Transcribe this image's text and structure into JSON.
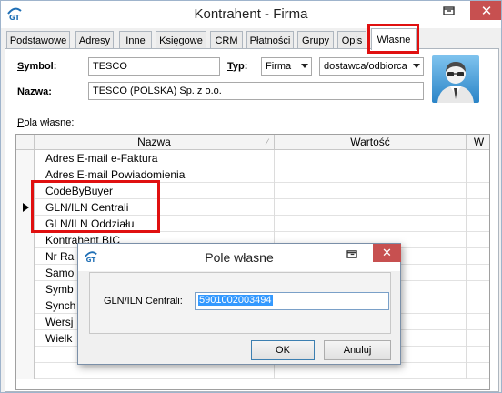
{
  "window": {
    "title": "Kontrahent - Firma",
    "close_glyph": "✕",
    "icons": [
      "app-logo-icon",
      "restore-icon",
      "close-icon"
    ]
  },
  "tabs": [
    {
      "label": "Podstawowe"
    },
    {
      "label": "Adresy"
    },
    {
      "label": "Inne"
    },
    {
      "label": "Księgowe"
    },
    {
      "label": "CRM"
    },
    {
      "label": "Płatności"
    },
    {
      "label": "Grupy"
    },
    {
      "label": "Opis"
    },
    {
      "label": "Własne",
      "active": true
    }
  ],
  "form": {
    "symbol_label_u": "S",
    "symbol_label_rest": "ymbol:",
    "symbol_value": "TESCO",
    "typ_label_u": "T",
    "typ_label_rest": "yp:",
    "typ_value": "Firma",
    "role_value": "dostawca/odbiorca",
    "nazwa_label_u": "N",
    "nazwa_label_rest": "azwa:",
    "nazwa_value": "TESCO (POLSKA) Sp. z o.o."
  },
  "grid": {
    "section_label_u": "P",
    "section_label_rest": "ola własne:",
    "columns": [
      "Nazwa",
      "Wartość",
      "W"
    ],
    "rows": [
      {
        "name": "Adres E-mail e-Faktura"
      },
      {
        "name": "Adres E-mail Powiadomienia"
      },
      {
        "name": "CodeByBuyer"
      },
      {
        "name": "GLN/ILN Centrali",
        "current": true
      },
      {
        "name": "GLN/ILN Oddziału"
      },
      {
        "name": "Kontrahent BIC"
      },
      {
        "name": "Nr Ra"
      },
      {
        "name": "Samo"
      },
      {
        "name": "Symb"
      },
      {
        "name": "Synch"
      },
      {
        "name": "Wersj"
      },
      {
        "name": "Wielk"
      },
      {
        "name": ""
      },
      {
        "name": ""
      }
    ]
  },
  "dialog": {
    "title": "Pole własne",
    "close_glyph": "✕",
    "field_label": "GLN/ILN Centrali:",
    "field_value": "5901002003494",
    "ok_label": "OK",
    "cancel_label": "Anuluj"
  },
  "colors": {
    "highlight_red": "#e01010",
    "selection_blue": "#3399ff",
    "close_red": "#c75050"
  }
}
